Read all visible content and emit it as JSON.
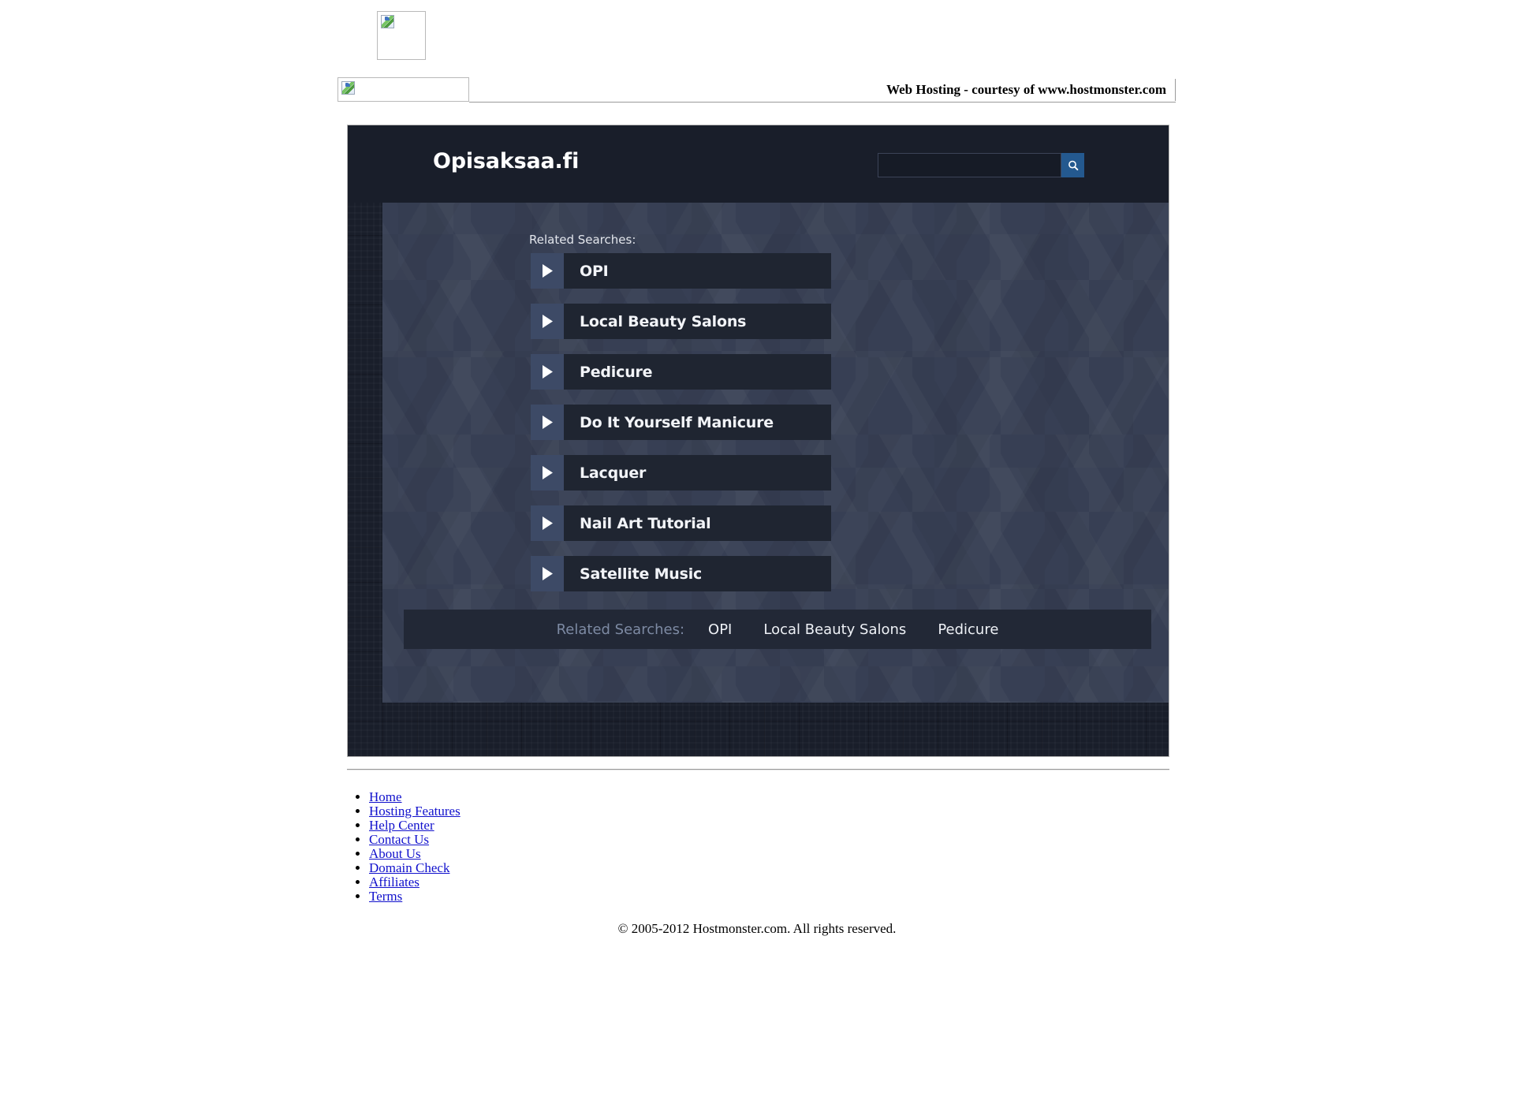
{
  "top_banner": {
    "logo_placeholder_icon": "broken-image-icon",
    "banner_placeholder_icon": "broken-image-icon",
    "courtesy_text": "Web Hosting - courtesy of www.hostmonster.com"
  },
  "parked_page": {
    "site_title": "Opisaksaa.fi",
    "search": {
      "value": "",
      "placeholder": "",
      "button_icon": "search-icon"
    },
    "related_label": "Related Searches:",
    "results": [
      {
        "label": "OPI",
        "icon": "play-triangle-icon"
      },
      {
        "label": "Local Beauty Salons",
        "icon": "play-triangle-icon"
      },
      {
        "label": "Pedicure",
        "icon": "play-triangle-icon"
      },
      {
        "label": "Do It Yourself Manicure",
        "icon": "play-triangle-icon"
      },
      {
        "label": "Lacquer",
        "icon": "play-triangle-icon"
      },
      {
        "label": "Nail Art Tutorial",
        "icon": "play-triangle-icon"
      },
      {
        "label": "Satellite Music",
        "icon": "play-triangle-icon"
      }
    ],
    "related_bar": {
      "label": "Related Searches:",
      "links": [
        "OPI",
        "Local Beauty Salons",
        "Pedicure"
      ]
    },
    "colors": {
      "page_bg": "#191e2a",
      "panel_bg": "#373f54",
      "item_bg": "#1f2531",
      "item_arrow_bg": "#3d4a66",
      "accent_blue": "#24598f",
      "related_bar_bg": "#222836",
      "muted_text": "#7d8aa3"
    }
  },
  "footer": {
    "links": [
      "Home",
      "Hosting Features",
      "Help Center",
      "Contact Us",
      "About Us",
      "Domain Check",
      "Affiliates",
      "Terms"
    ],
    "copyright": "© 2005-2012 Hostmonster.com. All rights reserved."
  }
}
